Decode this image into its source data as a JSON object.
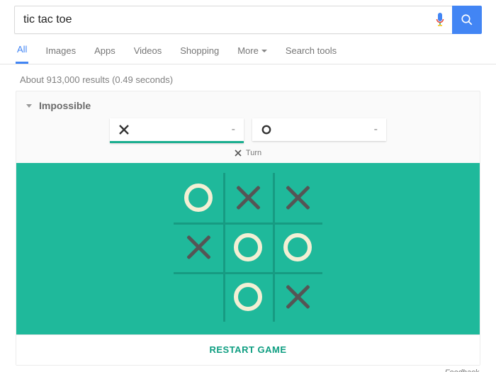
{
  "search": {
    "query": "tic tac toe"
  },
  "tabs": {
    "all": "All",
    "images": "Images",
    "apps": "Apps",
    "videos": "Videos",
    "shopping": "Shopping",
    "more": "More",
    "search_tools": "Search tools"
  },
  "result_stats": "About 913,000 results (0.49 seconds)",
  "game": {
    "difficulty": "Impossible",
    "score_x": "-",
    "score_o": "-",
    "turn_symbol": "X",
    "turn_label": "Turn",
    "board": [
      [
        "O",
        "X",
        "X"
      ],
      [
        "X",
        "O",
        "O"
      ],
      [
        "",
        "O",
        "X"
      ]
    ],
    "restart_label": "RESTART GAME"
  },
  "feedback_label": "Feedback",
  "colors": {
    "accent_blue": "#4285f4",
    "board_bg": "#1fb99b",
    "o_color": "#f3efd4",
    "x_color": "#555555",
    "teal_text": "#0e9e81"
  }
}
